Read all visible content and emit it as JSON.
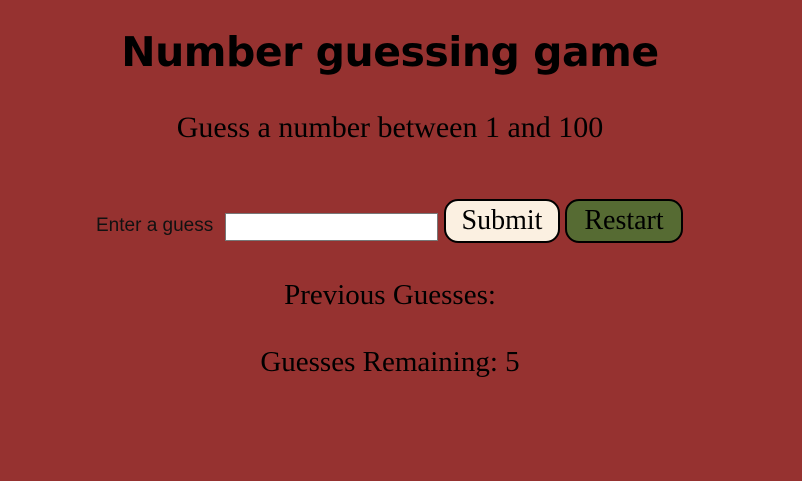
{
  "game": {
    "title": "Number guessing game",
    "subtitle": "Guess a number between 1 and 100"
  },
  "form": {
    "guess_label": "Enter a guess",
    "guess_value": "",
    "submit_label": "Submit",
    "restart_label": "Restart"
  },
  "status": {
    "previous_guesses_label": "Previous Guesses:",
    "previous_guesses": "",
    "remaining_label": "Guesses Remaining:",
    "remaining_count": "5"
  },
  "colors": {
    "background": "#963230",
    "submit_button": "#fbf0e1",
    "restart_button": "#566b33"
  }
}
